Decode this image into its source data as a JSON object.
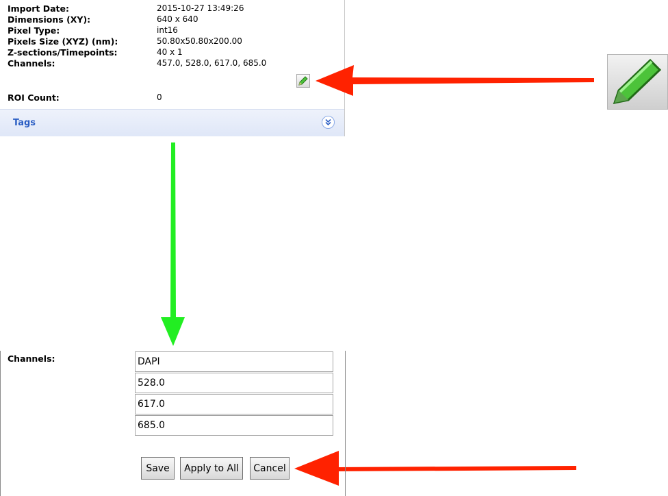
{
  "metadata": {
    "rows": [
      {
        "label": "Import Date:",
        "value": "2015-10-27 13:49:26"
      },
      {
        "label": "Dimensions (XY):",
        "value": "640 x 640"
      },
      {
        "label": "Pixel Type:",
        "value": "int16"
      },
      {
        "label": "Pixels Size (XYZ) (nm):",
        "value": "50.80x50.80x200.00"
      },
      {
        "label": "Z-sections/Timepoints:",
        "value": "40 x 1"
      },
      {
        "label": "Channels:",
        "value": "457.0, 528.0, 617.0, 685.0"
      },
      {
        "label": "ROI Count:",
        "value": "0"
      }
    ],
    "tags_label": "Tags"
  },
  "channel_editor": {
    "label": "Channels:",
    "channels": [
      "DAPI",
      "528.0",
      "617.0",
      "685.0"
    ],
    "buttons": {
      "save": "Save",
      "apply_all": "Apply to All",
      "cancel": "Cancel"
    }
  },
  "colors": {
    "arrow_red": "#ff2200",
    "arrow_green": "#22ee22",
    "tags_text": "#2c5fc4",
    "pencil_green": "#4cc33a"
  },
  "icons": {
    "edit": "pencil-icon",
    "expand": "double-chevron-down-icon"
  }
}
